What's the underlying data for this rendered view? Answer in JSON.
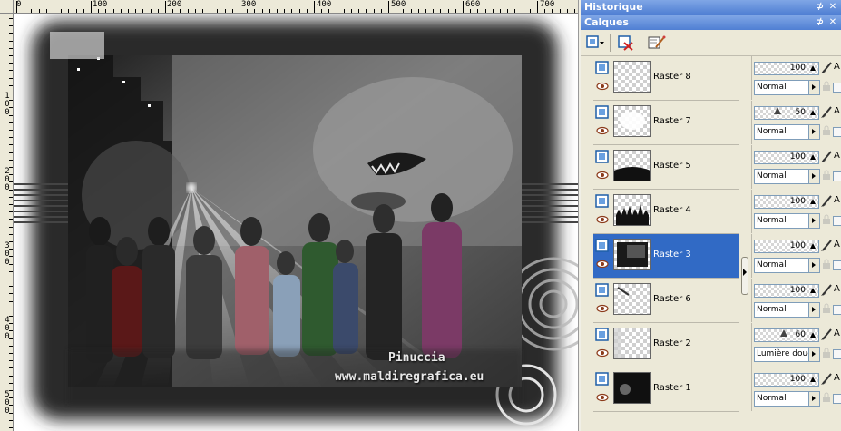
{
  "ruler": {
    "top_labels": [
      "0",
      "100",
      "200",
      "300",
      "400",
      "500",
      "600",
      "700"
    ],
    "left_labels": [
      "1\n0\n0",
      "2\n0\n0",
      "3\n0\n0",
      "4\n0\n0",
      "5\n0\n0"
    ]
  },
  "artwork": {
    "signature": "Pinuccia",
    "website": "www.maldiregrafica.eu"
  },
  "panels": {
    "history": {
      "title": "Historique",
      "pin": "⊅",
      "close": "✕"
    },
    "layers": {
      "title": "Calques",
      "pin": "⊅",
      "close": "✕"
    }
  },
  "toolbar": {
    "icons": [
      "new-layer-icon",
      "dropdown-arrow-icon",
      "delete-layer-icon",
      "properties-icon"
    ]
  },
  "layers": [
    {
      "name": "Raster 8",
      "opacity": "100",
      "opacity_level": 1.0,
      "blend": "Normal",
      "thumb": "transparent",
      "selected": false
    },
    {
      "name": "Raster 7",
      "opacity": "50",
      "opacity_level": 0.5,
      "blend": "Normal",
      "thumb": "light-glow",
      "selected": false
    },
    {
      "name": "Raster 5",
      "opacity": "100",
      "opacity_level": 1.0,
      "blend": "Normal",
      "thumb": "dark-edge",
      "selected": false
    },
    {
      "name": "Raster 4",
      "opacity": "100",
      "opacity_level": 1.0,
      "blend": "Normal",
      "thumb": "silhouettes",
      "selected": false
    },
    {
      "name": "Raster 3",
      "opacity": "100",
      "opacity_level": 1.0,
      "blend": "Normal",
      "thumb": "dark-frame",
      "selected": true
    },
    {
      "name": "Raster 6",
      "opacity": "100",
      "opacity_level": 1.0,
      "blend": "Normal",
      "thumb": "stroke",
      "selected": false
    },
    {
      "name": "Raster 2",
      "opacity": "60",
      "opacity_level": 0.6,
      "blend": "Lumière douce",
      "thumb": "soft-gray",
      "selected": false
    },
    {
      "name": "Raster 1",
      "opacity": "100",
      "opacity_level": 1.0,
      "blend": "Normal",
      "thumb": "dark-bg",
      "selected": false
    }
  ],
  "layer_controls": {
    "alpha_label": "A"
  },
  "colors": {
    "header": "#4f7fd3",
    "selected_row": "#316ac5",
    "panel_bg": "#ece9d8"
  }
}
